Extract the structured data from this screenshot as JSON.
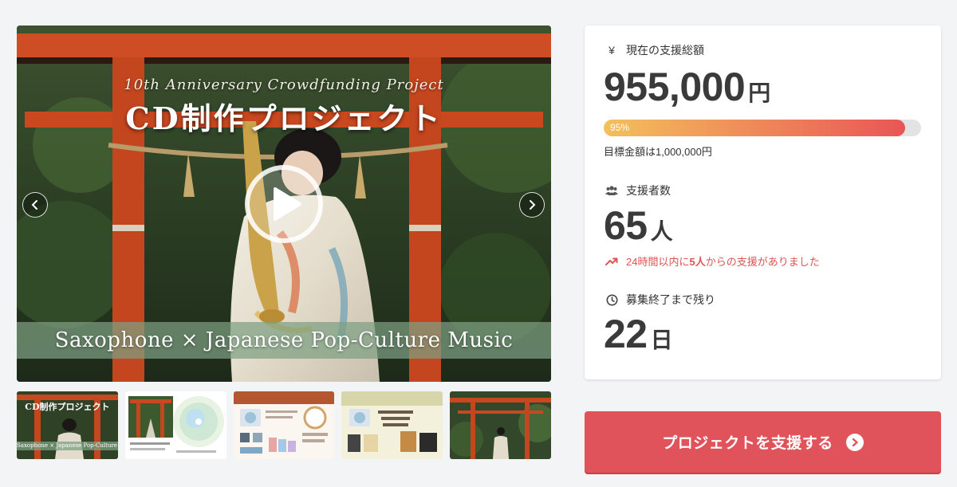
{
  "main_visual": {
    "subtitle": "10th Anniversary Crowdfunding Project",
    "title": "CD制作プロジェクト",
    "band_text": "Saxophone × Japanese Pop-Culture Music"
  },
  "thumbnails": [
    {
      "caption": "CD制作プロジェクト",
      "band": "Saxophone × Japanese Pop-Culture Music"
    },
    {
      "caption": ""
    },
    {
      "caption": ""
    },
    {
      "caption": ""
    },
    {
      "caption": ""
    }
  ],
  "funding": {
    "icon": "yen-icon",
    "label": "現在の支援総額",
    "amount": "955,000",
    "unit": "円",
    "progress_percent": 95,
    "progress_label": "95%",
    "goal_text": "目標金額は1,000,000円"
  },
  "backers": {
    "icon": "users-icon",
    "label": "支援者数",
    "count": "65",
    "unit": "人",
    "trend_prefix": "24時間以内に",
    "trend_count": "5人",
    "trend_suffix": "からの支援がありました"
  },
  "remaining": {
    "icon": "clock-icon",
    "label": "募集終了まで残り",
    "days": "22",
    "unit": "日"
  },
  "cta": {
    "label": "プロジェクトを支援する"
  },
  "colors": {
    "accent": "#e0535a",
    "progress_start": "#f3c15a",
    "progress_end": "#ea5556",
    "trend": "#e05353"
  }
}
